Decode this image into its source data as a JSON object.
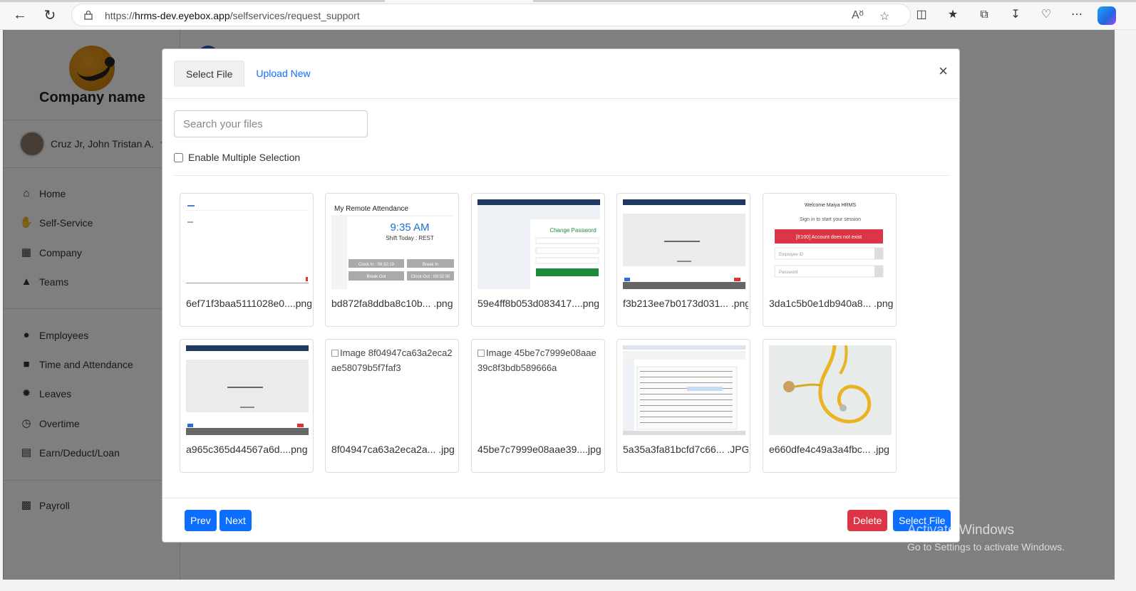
{
  "browser": {
    "url_prefix": "https://",
    "url_host": "hrms-dev.eyebox.app",
    "url_path": "/selfservices/request_support"
  },
  "sidebar": {
    "company": "Company name",
    "user": "Cruz Jr, John Tristan A.",
    "items": [
      {
        "label": "Home",
        "icon": "home-icon"
      },
      {
        "label": "Self-Service",
        "icon": "hand-icon"
      },
      {
        "label": "Company",
        "icon": "building-icon"
      },
      {
        "label": "Teams",
        "icon": "teams-icon"
      },
      {
        "label": "Employees",
        "icon": "users-icon"
      },
      {
        "label": "Time and Attendance",
        "icon": "clock-briefcase-icon"
      },
      {
        "label": "Leaves",
        "icon": "leave-icon"
      },
      {
        "label": "Overtime",
        "icon": "overtime-icon"
      },
      {
        "label": "Earn/Deduct/Loan",
        "icon": "money-icon"
      },
      {
        "label": "Payroll",
        "icon": "payroll-icon"
      }
    ]
  },
  "modal": {
    "tab_select": "Select File",
    "tab_upload": "Upload New",
    "close": "×",
    "search_placeholder": "Search your files",
    "multi_label": "Enable Multiple Selection",
    "files": [
      {
        "name": "6ef71f3baa5111028e0....png",
        "thumb": "blank-page"
      },
      {
        "name": "bd872fa8ddba8c10b... .png",
        "thumb": "attendance"
      },
      {
        "name": "59e4ff8b053d083417....png",
        "thumb": "change-password"
      },
      {
        "name": "f3b213ee7b0173d031... .png",
        "thumb": "gray-page"
      },
      {
        "name": "3da1c5b0e1db940a8... .png",
        "thumb": "login"
      },
      {
        "name": "a965c365d44567a6d....png",
        "thumb": "gray-page"
      },
      {
        "name": "8f04947ca63a2eca2a... .jpg",
        "thumb": "broken",
        "alt": "Image 8f04947ca63a2eca2ae58079b5f7faf3"
      },
      {
        "name": "45be7c7999e08aae39....jpg",
        "thumb": "broken",
        "alt": "Image 45be7c7999e08aae39c8f3bdb589666a"
      },
      {
        "name": "5a35a3fa81bcfd7c66... .JPG",
        "thumb": "spreadsheet"
      },
      {
        "name": "e660dfe4c49a3a4fbc... .jpg",
        "thumb": "stethoscope"
      }
    ],
    "thumb_text": {
      "attendance_title": "My Remote Attendance",
      "attendance_time": "9:35 AM",
      "attendance_shift": "Shift Today : REST",
      "clock_in": "Clock In : 09:32:19",
      "break_in": "Break In",
      "break_out": "Break Out",
      "clock_out": "Clock Out : 09:32:30",
      "change_password": "Change Password",
      "login_welcome": "Welcome Maiya HRMS",
      "login_sub": "Sign in to start your session",
      "login_error": "[E100] Account does not exist",
      "login_emp": "Employee ID",
      "login_pw": "Password"
    },
    "prev": "Prev",
    "next": "Next",
    "delete": "Delete",
    "select": "Select File"
  },
  "watermark": {
    "line1": "Activate Windows",
    "line2": "Go to Settings to activate Windows."
  },
  "colors": {
    "primary": "#0d6efd",
    "danger": "#dc3545"
  }
}
